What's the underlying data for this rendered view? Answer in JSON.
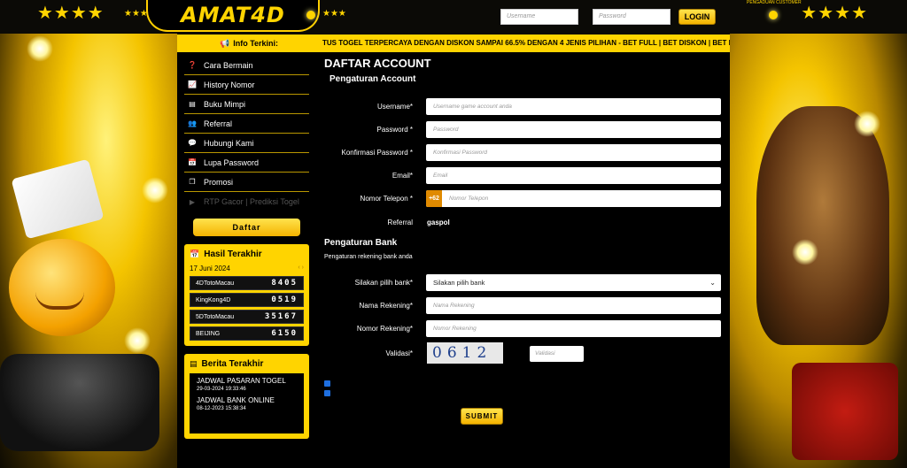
{
  "header": {
    "logo": "AMAT4D",
    "username_placeholder": "Username",
    "password_placeholder": "Password",
    "login_label": "LOGIN",
    "cs_label": "PENGADUAN CUSTOMER"
  },
  "info": {
    "label": "Info Terkini:",
    "marquee": "TUS TOGEL TERPERCAYA DENGAN DISKON SAMPAI 66.5% DENGAN 4 JENIS PILIHAN - BET FULL | BET DISKON | BET BB | BET"
  },
  "sidebar": {
    "items": [
      {
        "label": "Cara Bermain",
        "icon": "question-circle-icon"
      },
      {
        "label": "History Nomor",
        "icon": "chart-line-icon"
      },
      {
        "label": "Buku Mimpi",
        "icon": "book-icon"
      },
      {
        "label": "Referral",
        "icon": "referral-icon"
      },
      {
        "label": "Hubungi Kami",
        "icon": "chat-icon"
      },
      {
        "label": "Lupa Password",
        "icon": "calendar-icon"
      },
      {
        "label": "Promosi",
        "icon": "promo-icon"
      },
      {
        "label": "RTP Gacor | Prediksi Togel",
        "icon": "play-circle-icon"
      }
    ],
    "daftar_label": "Daftar"
  },
  "hasil": {
    "title": "Hasil Terakhir",
    "date": "17 Juni 2024",
    "rows": [
      {
        "market": "4DTotoMacau",
        "number": "8405"
      },
      {
        "market": "KingKong4D",
        "number": "0519"
      },
      {
        "market": "5DTotoMacau",
        "number": "35167"
      },
      {
        "market": "BEIJING",
        "number": "6150"
      }
    ]
  },
  "berita": {
    "title": "Berita Terakhir",
    "items": [
      {
        "title": "JADWAL PASARAN TOGEL",
        "date": "29-03-2024 19:33:46"
      },
      {
        "title": "JADWAL BANK ONLINE",
        "date": "08-12-2023 15:38:34"
      }
    ]
  },
  "form": {
    "title": "DAFTAR ACCOUNT",
    "section_account": "Pengaturan Account",
    "username_label": "Username*",
    "username_placeholder": "Username game account anda",
    "password_label": "Password *",
    "password_placeholder": "Password",
    "confirm_label": "Konfirmasi Password *",
    "confirm_placeholder": "Konfirmasi Password",
    "email_label": "Email*",
    "email_placeholder": "Email",
    "phone_label": "Nomor Telepon *",
    "phone_prefix": "+62",
    "phone_placeholder": "Nomor Telepon",
    "referral_label": "Referral",
    "referral_value": "gaspol",
    "section_bank": "Pengaturan Bank",
    "section_bank_sub": "Pengaturan rekening bank anda",
    "bank_label": "Silakan pilih bank*",
    "bank_selected": "Silakan pilih bank",
    "rek_name_label": "Nama Rekening*",
    "rek_name_placeholder": "Nama Rekening",
    "rek_no_label": "Nomor Rekening*",
    "rek_no_placeholder": "Nomor Rekening",
    "validasi_label": "Validasi*",
    "captcha": "0612",
    "validasi_placeholder": "Validasi",
    "submit_label": "SUBMIT"
  }
}
